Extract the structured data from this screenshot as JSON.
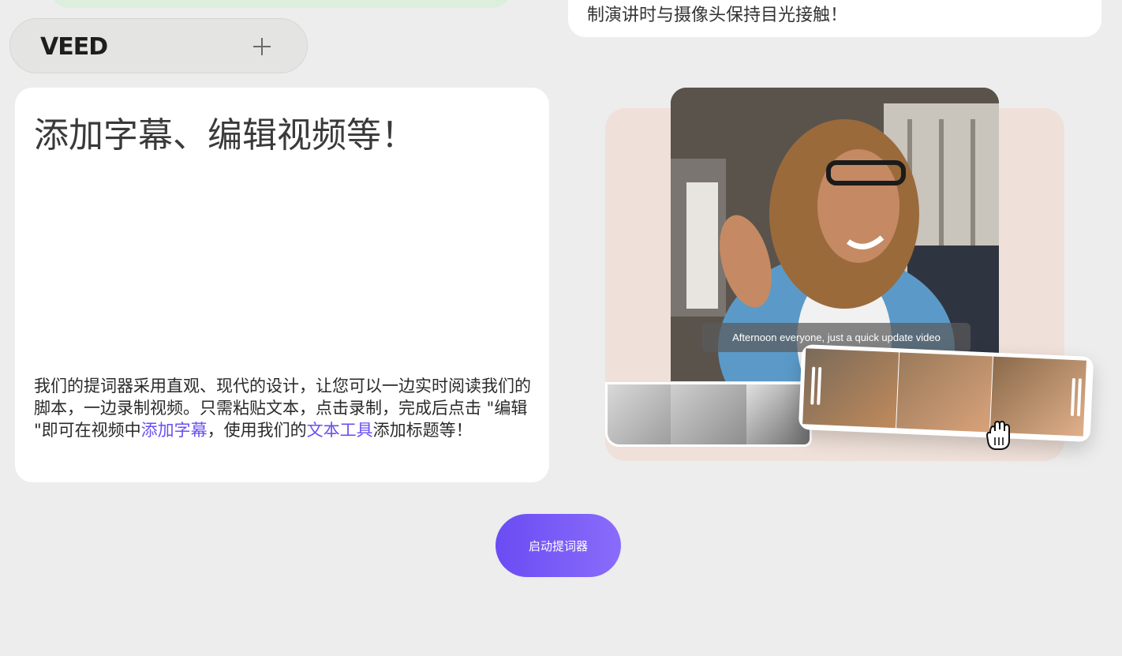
{
  "top_card": {
    "text": "制演讲时与摄像头保持目光接触！"
  },
  "brand": {
    "logo_text": "VEED",
    "expand_icon": "plus-icon"
  },
  "feature_card": {
    "title": "添加字幕、编辑视频等！",
    "desc_part1": "我们的提词器采用直观、现代的设计，让您可以一边实时阅读我们的脚本，一边录制视频。只需粘贴文本，点击录制，完成后点击 \"编辑 \"即可在视频中",
    "link_subtitles": "添加字幕",
    "desc_part2": "，使用我们的",
    "link_text_tool": "文本工具",
    "desc_part3": "添加标题等！"
  },
  "media": {
    "caption": "Afternoon everyone, just a quick update video",
    "cursor_icon": "grab-hand-icon"
  },
  "cta": {
    "label": "启动提词器"
  },
  "colors": {
    "accent": "#6b4ff0",
    "background": "#ecedec",
    "media_bg": "#efe1d9"
  }
}
